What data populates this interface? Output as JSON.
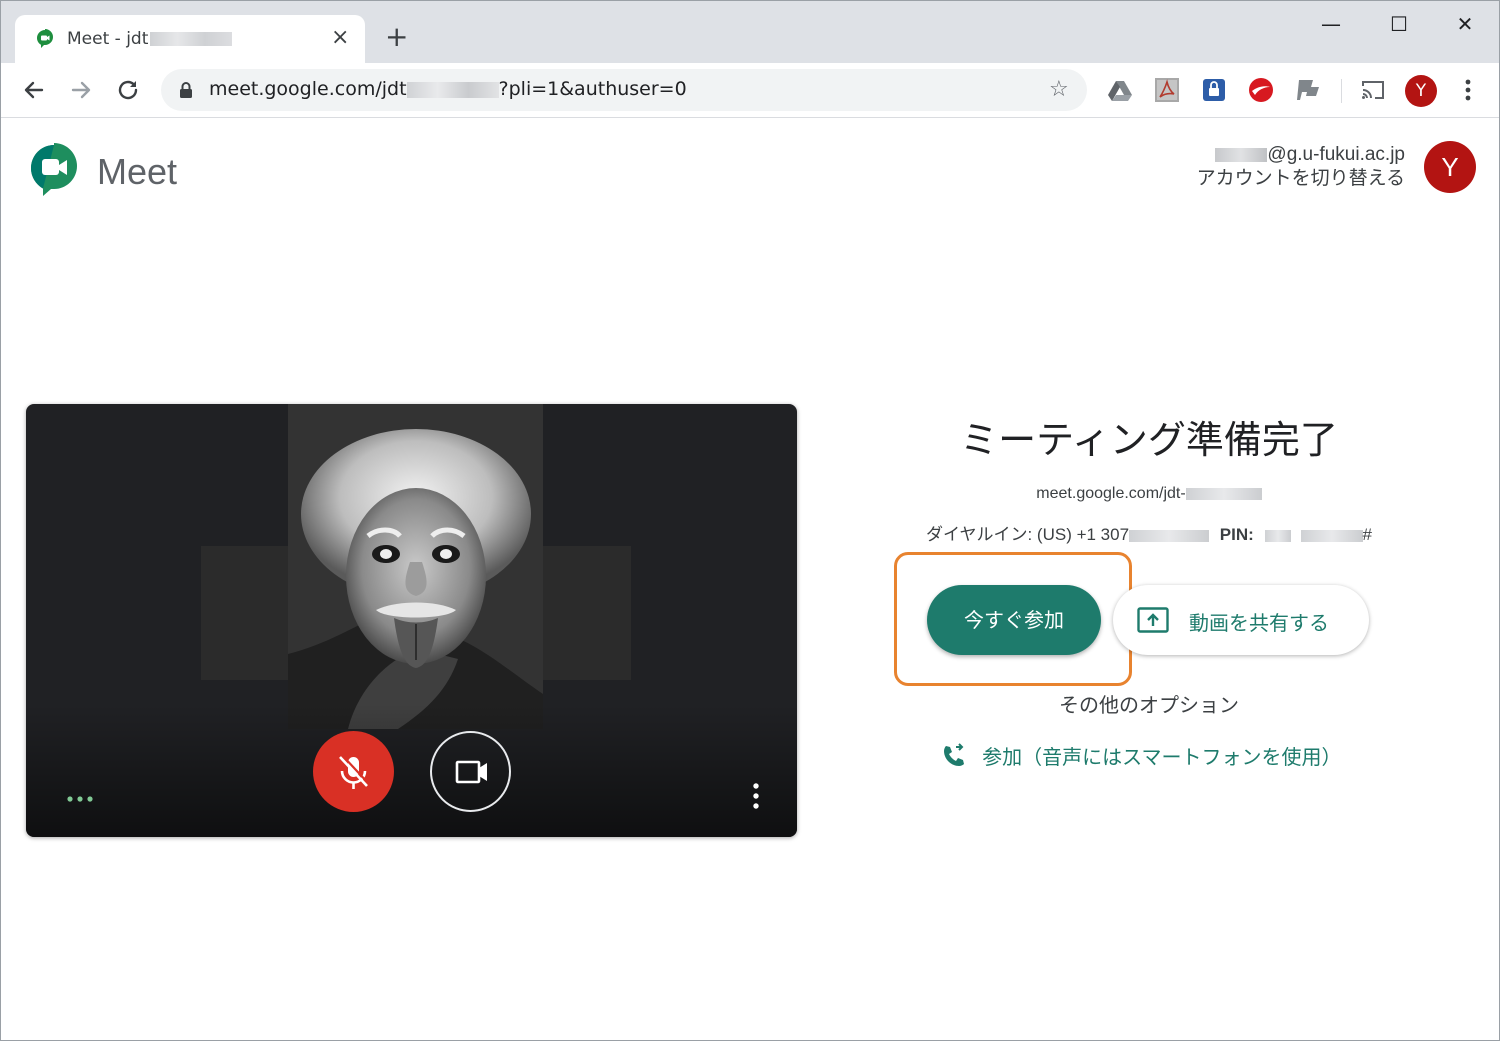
{
  "browser": {
    "tab_title": "Meet - jdt",
    "tab_close": "×",
    "new_tab": "+",
    "url_prefix": "meet.google.com/jdt",
    "url_suffix": "?pli=1&authuser=0",
    "profile_initial": "Y",
    "window_controls": {
      "minimize": "—",
      "maximize": "☐",
      "close": "✕"
    }
  },
  "header": {
    "logo_text": "Meet",
    "account_email": "@g.u-fukui.ac.jp",
    "account_switch": "アカウントを切り替える",
    "avatar_initial": "Y"
  },
  "right_panel": {
    "title": "ミーティング準備完了",
    "meeting_url": "meet.google.com/jdt-",
    "dialin_label": "ダイヤルイン: (US) +1 307",
    "pin_label": "PIN:",
    "pin_suffix": "#",
    "join_now": "今すぐ参加",
    "present": "動画を共有する",
    "other_options": "その他のオプション",
    "phone_audio": "参加（音声にはスマートフォンを使用）"
  },
  "colors": {
    "primary": "#1e7b6c",
    "mic_off": "#d93025",
    "highlight": "#e8832f",
    "avatar": "#b31412"
  },
  "icons": [
    "meet-favicon-icon",
    "back-arrow-icon",
    "forward-arrow-icon",
    "reload-icon",
    "lock-icon",
    "star-icon",
    "drive-extension-icon",
    "acrobat-extension-icon",
    "password-extension-icon",
    "security-extension-icon",
    "flag-extension-icon",
    "cast-icon",
    "menu-dots-icon",
    "meet-logo-icon",
    "mic-off-icon",
    "camera-icon",
    "effects-dots-icon",
    "more-vert-icon",
    "present-screen-icon",
    "phone-forward-icon"
  ]
}
